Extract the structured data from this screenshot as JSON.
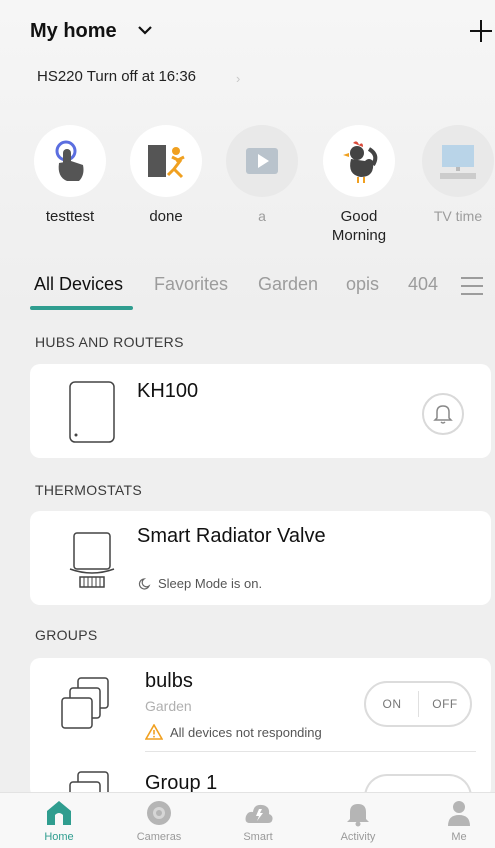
{
  "header": {
    "title": "My home",
    "schedule": "HS220 Turn off at 16:36",
    "schedule_arrow": "›"
  },
  "scenes": [
    {
      "label": "testtest"
    },
    {
      "label": "done"
    },
    {
      "label": "a"
    },
    {
      "label": "Good\nMorning"
    },
    {
      "label": "TV time"
    }
  ],
  "tabs": [
    "All Devices",
    "Favorites",
    "Garden",
    "opis",
    "404"
  ],
  "sections": {
    "hubs": "HUBS AND ROUTERS",
    "thermostats": "THERMOSTATS",
    "groups": "GROUPS"
  },
  "devices": {
    "hub": {
      "name": "KH100"
    },
    "valve": {
      "name": "Smart Radiator Valve",
      "status": "Sleep Mode is on."
    },
    "group1": {
      "name": "bulbs",
      "room": "Garden",
      "warning": "All devices not responding",
      "on": "ON",
      "off": "OFF"
    },
    "group2": {
      "name": "Group 1"
    }
  },
  "nav": [
    {
      "label": "Home"
    },
    {
      "label": "Cameras"
    },
    {
      "label": "Smart"
    },
    {
      "label": "Activity"
    },
    {
      "label": "Me"
    }
  ],
  "colors": {
    "accent": "#2f9d8f",
    "warning": "#f0a020"
  }
}
